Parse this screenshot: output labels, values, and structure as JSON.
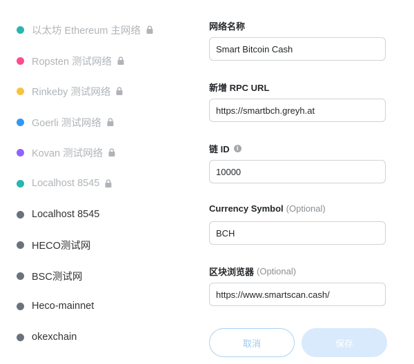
{
  "networks": [
    {
      "label": "以太坊 Ethereum 主网络",
      "color": "#29b6af",
      "locked": true,
      "muted": true
    },
    {
      "label": "Ropsten 测试网络",
      "color": "#ff4a8d",
      "locked": true,
      "muted": true
    },
    {
      "label": "Rinkeby 测试网络",
      "color": "#f6c343",
      "locked": true,
      "muted": true
    },
    {
      "label": "Goerli 测试网络",
      "color": "#3099f2",
      "locked": true,
      "muted": true
    },
    {
      "label": "Kovan 测试网络",
      "color": "#9064ff",
      "locked": true,
      "muted": true
    },
    {
      "label": "Localhost 8545",
      "color": "#29b6af",
      "locked": true,
      "muted": true
    },
    {
      "label": "Localhost 8545",
      "color": "#6a737d",
      "locked": false,
      "muted": false
    },
    {
      "label": "HECO测试网",
      "color": "#6a737d",
      "locked": false,
      "muted": false
    },
    {
      "label": "BSC测试网",
      "color": "#6a737d",
      "locked": false,
      "muted": false
    },
    {
      "label": "Heco-mainnet",
      "color": "#6a737d",
      "locked": false,
      "muted": false
    },
    {
      "label": "okexchain",
      "color": "#6a737d",
      "locked": false,
      "muted": false
    }
  ],
  "form": {
    "network_name": {
      "label": "网络名称",
      "value": "Smart Bitcoin Cash"
    },
    "rpc_url": {
      "label": "新增 RPC URL",
      "value": "https://smartbch.greyh.at"
    },
    "chain_id": {
      "label": "链 ID",
      "value": "10000"
    },
    "currency_symbol": {
      "label": "Currency Symbol",
      "optional": "(Optional)",
      "value": "BCH"
    },
    "block_explorer": {
      "label": "区块浏览器",
      "optional": "(Optional)",
      "value": "https://www.smartscan.cash/"
    }
  },
  "buttons": {
    "cancel": "取消",
    "save": "保存"
  },
  "colors": {
    "accent": "#037dd6",
    "lock": "#b0b4b8"
  }
}
